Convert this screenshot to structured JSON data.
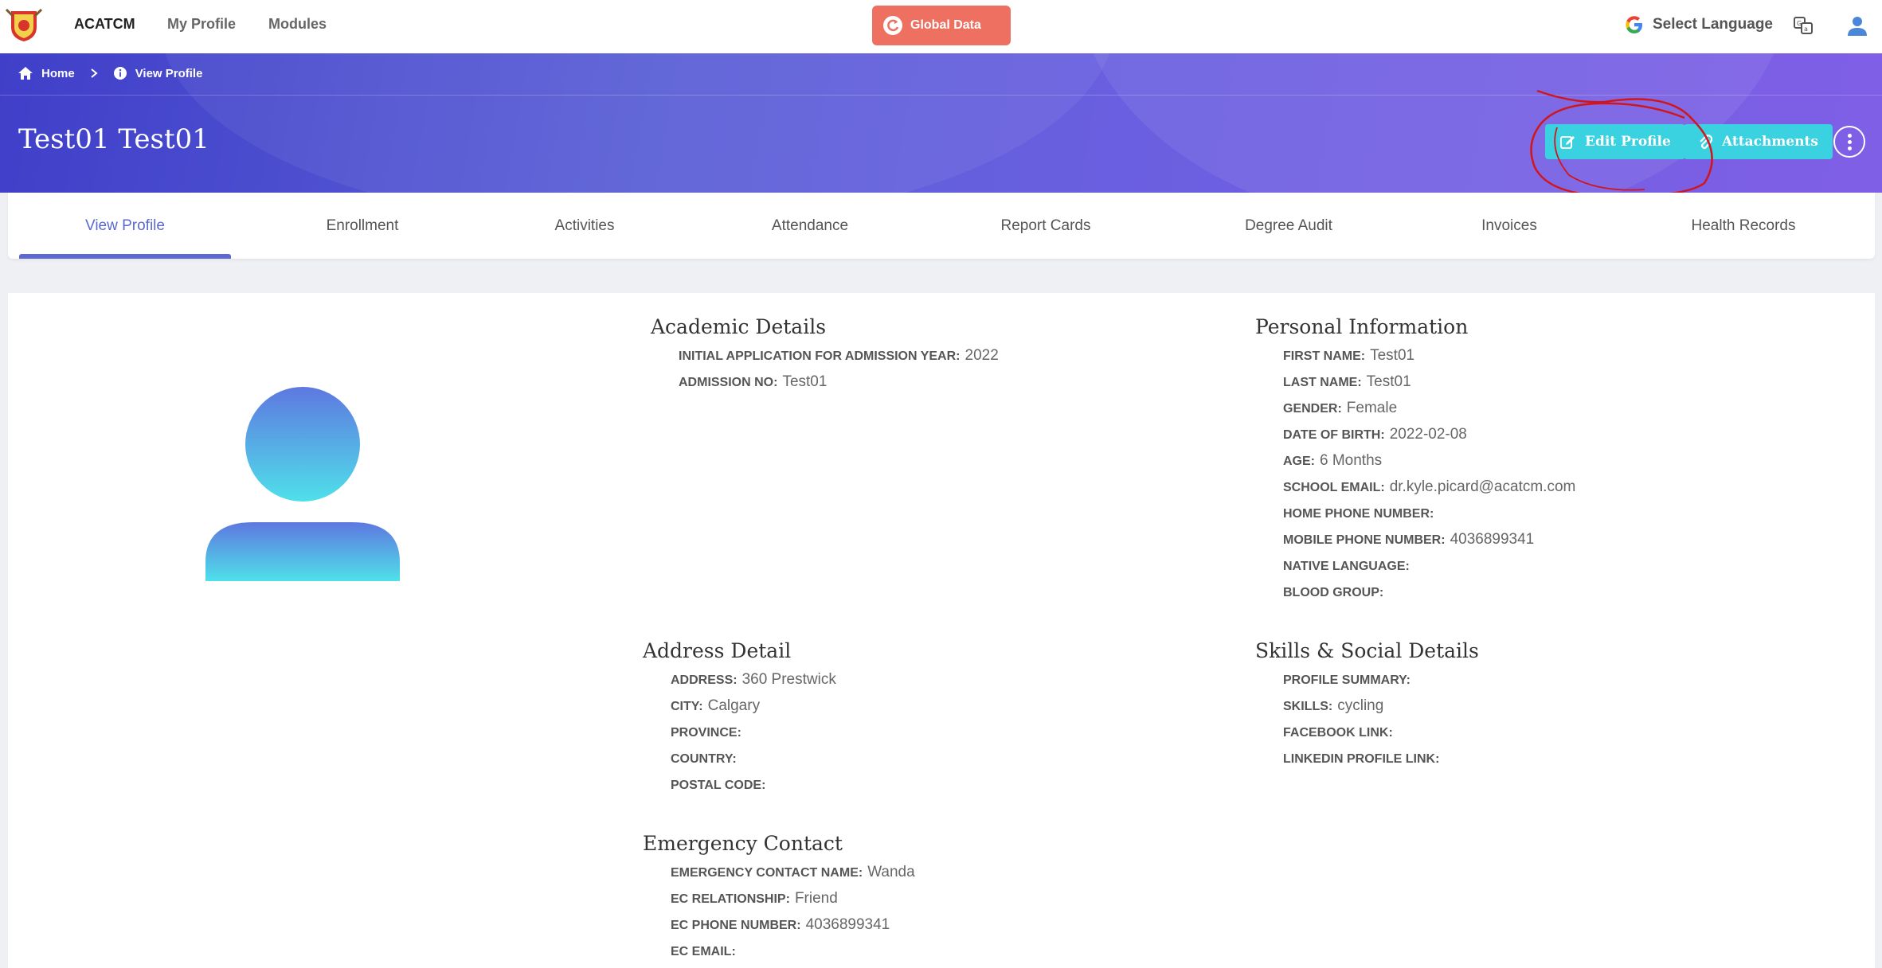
{
  "nav": {
    "brand": "ACATCM",
    "my_profile": "My Profile",
    "modules": "Modules",
    "global_data": "Global Data",
    "select_language": "Select Language"
  },
  "breadcrumb": {
    "home": "Home",
    "current": "View Profile"
  },
  "header": {
    "student_name": "Test01 Test01",
    "edit_profile": "Edit Profile",
    "attachments": "Attachments"
  },
  "tabs": [
    "View Profile",
    "Enrollment",
    "Activities",
    "Attendance",
    "Report Cards",
    "Degree Audit",
    "Invoices",
    "Health Records"
  ],
  "academic": {
    "title": "Academic Details",
    "fields": [
      {
        "label": "INITIAL APPLICATION FOR ADMISSION YEAR:",
        "value": "2022"
      },
      {
        "label": "ADMISSION NO:",
        "value": "Test01"
      }
    ]
  },
  "personal": {
    "title": "Personal Information",
    "fields": [
      {
        "label": "FIRST NAME:",
        "value": "Test01"
      },
      {
        "label": "LAST NAME:",
        "value": "Test01"
      },
      {
        "label": "GENDER:",
        "value": "Female"
      },
      {
        "label": "DATE OF BIRTH:",
        "value": "2022-02-08"
      },
      {
        "label": "AGE:",
        "value": "6 Months"
      },
      {
        "label": "SCHOOL EMAIL:",
        "value": "dr.kyle.picard@acatcm.com"
      },
      {
        "label": "HOME PHONE NUMBER:",
        "value": ""
      },
      {
        "label": "MOBILE PHONE NUMBER:",
        "value": "4036899341"
      },
      {
        "label": "NATIVE LANGUAGE:",
        "value": ""
      },
      {
        "label": "BLOOD GROUP:",
        "value": ""
      }
    ]
  },
  "address": {
    "title": "Address Detail",
    "fields": [
      {
        "label": "ADDRESS:",
        "value": "360 Prestwick"
      },
      {
        "label": "CITY:",
        "value": "Calgary"
      },
      {
        "label": "PROVINCE:",
        "value": ""
      },
      {
        "label": "COUNTRY:",
        "value": ""
      },
      {
        "label": "POSTAL CODE:",
        "value": ""
      }
    ]
  },
  "skills": {
    "title": "Skills & Social Details",
    "fields": [
      {
        "label": "PROFILE SUMMARY:",
        "value": ""
      },
      {
        "label": "SKILLS:",
        "value": "cycling"
      },
      {
        "label": "FACEBOOK LINK:",
        "value": ""
      },
      {
        "label": "LINKEDIN PROFILE LINK:",
        "value": ""
      }
    ]
  },
  "emergency": {
    "title": "Emergency Contact",
    "fields": [
      {
        "label": "EMERGENCY CONTACT NAME:",
        "value": "Wanda"
      },
      {
        "label": "EC RELATIONSHIP:",
        "value": "Friend"
      },
      {
        "label": "EC PHONE NUMBER:",
        "value": "4036899341"
      },
      {
        "label": "EC EMAIL:",
        "value": ""
      }
    ]
  },
  "colors": {
    "accent": "#5b6ad0",
    "button_cyan": "#3ad1e0",
    "global_btn": "#ee7061",
    "annotation": "#d0161c"
  },
  "icons": [
    "app-logo",
    "refresh-icon",
    "google-icon",
    "translate-icon",
    "user-icon",
    "home-icon",
    "chevron-right-icon",
    "info-icon",
    "edit-icon",
    "paperclip-icon",
    "more-vertical-icon"
  ]
}
